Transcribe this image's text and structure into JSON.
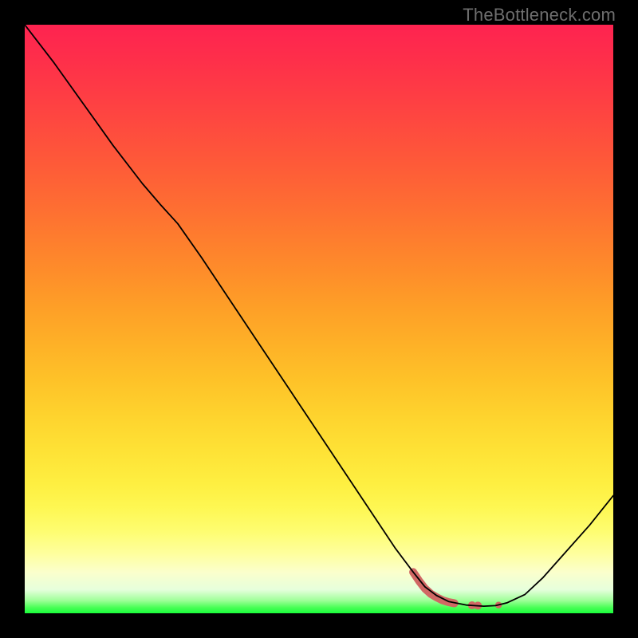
{
  "watermark": "TheBottleneck.com",
  "chart_data": {
    "type": "line",
    "title": "",
    "xlabel": "",
    "ylabel": "",
    "xlim": [
      0,
      100
    ],
    "ylim": [
      0,
      100
    ],
    "grid": false,
    "annotations": [],
    "gradient_stops": [
      {
        "offset": 0.0,
        "color": "#fe2350"
      },
      {
        "offset": 0.06,
        "color": "#fe2f4a"
      },
      {
        "offset": 0.12,
        "color": "#fe3d44"
      },
      {
        "offset": 0.18,
        "color": "#fe4c3e"
      },
      {
        "offset": 0.24,
        "color": "#fe5b38"
      },
      {
        "offset": 0.3,
        "color": "#fe6b33"
      },
      {
        "offset": 0.36,
        "color": "#fe7c2e"
      },
      {
        "offset": 0.42,
        "color": "#fe8d2a"
      },
      {
        "offset": 0.48,
        "color": "#fe9f27"
      },
      {
        "offset": 0.54,
        "color": "#feb027"
      },
      {
        "offset": 0.6,
        "color": "#fec128"
      },
      {
        "offset": 0.66,
        "color": "#fed22d"
      },
      {
        "offset": 0.72,
        "color": "#fee135"
      },
      {
        "offset": 0.78,
        "color": "#feef41"
      },
      {
        "offset": 0.82,
        "color": "#fef752"
      },
      {
        "offset": 0.86,
        "color": "#fefd70"
      },
      {
        "offset": 0.9,
        "color": "#feff9f"
      },
      {
        "offset": 0.93,
        "color": "#fbffcc"
      },
      {
        "offset": 0.96,
        "color": "#e6ffdc"
      },
      {
        "offset": 0.978,
        "color": "#a0ff9a"
      },
      {
        "offset": 0.99,
        "color": "#4bff57"
      },
      {
        "offset": 1.0,
        "color": "#19fd3a"
      }
    ],
    "series": [
      {
        "name": "bottleneck-curve",
        "stroke": "#000000",
        "stroke_width": 1.8,
        "x": [
          0.0,
          5.0,
          10.0,
          15.0,
          20.0,
          23.0,
          26.0,
          30.0,
          35.0,
          40.0,
          45.0,
          50.0,
          55.0,
          60.0,
          63.0,
          66.0,
          68.0,
          70.0,
          72.0,
          75.0,
          78.0,
          80.0,
          82.0,
          85.0,
          88.0,
          92.0,
          96.0,
          100.0
        ],
        "values": [
          100.0,
          93.5,
          86.5,
          79.5,
          73.0,
          69.5,
          66.2,
          60.5,
          53.0,
          45.5,
          38.0,
          30.5,
          23.0,
          15.5,
          11.0,
          7.0,
          4.5,
          3.0,
          2.0,
          1.4,
          1.2,
          1.3,
          1.8,
          3.2,
          6.0,
          10.5,
          15.0,
          20.0
        ]
      }
    ],
    "highlights": {
      "name": "optimal-range-marker",
      "stroke": "#d06764",
      "stroke_width": 10,
      "points": [
        {
          "x": 66.0,
          "y": 7.0
        },
        {
          "x": 67.0,
          "y": 5.5
        },
        {
          "x": 68.0,
          "y": 4.2
        },
        {
          "x": 69.0,
          "y": 3.3
        },
        {
          "x": 70.0,
          "y": 2.7
        },
        {
          "x": 71.0,
          "y": 2.2
        },
        {
          "x": 72.0,
          "y": 1.9
        },
        {
          "x": 73.0,
          "y": 1.7
        }
      ],
      "extra_dots": [
        {
          "x": 76.0,
          "y": 1.35
        },
        {
          "x": 77.0,
          "y": 1.3
        },
        {
          "x": 80.5,
          "y": 1.4
        }
      ]
    }
  }
}
